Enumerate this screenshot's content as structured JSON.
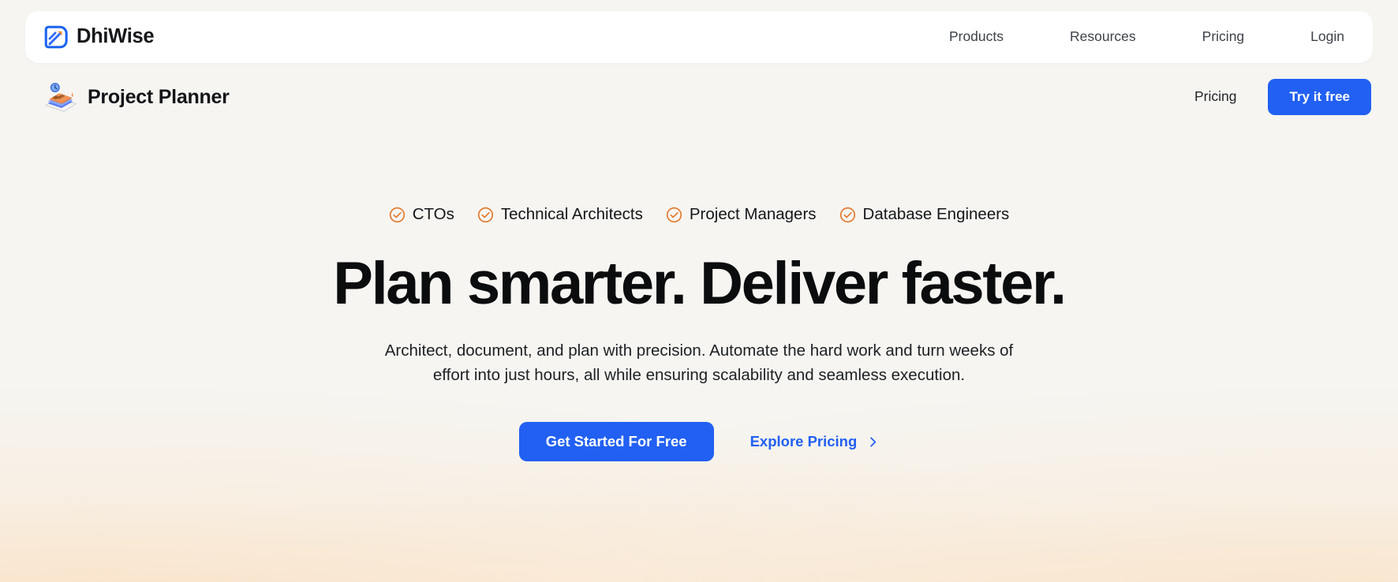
{
  "colors": {
    "page_bg": "#f6f5f1",
    "card_bg": "#ffffff",
    "accent_blue": "#2160f2",
    "accent_orange": "#e2762a",
    "text_dark": "#0b0c0e",
    "glow_peach": "#faddbe"
  },
  "topnav": {
    "brand": {
      "name": "DhiWise",
      "logo_icon": "dhiwise-logo-icon"
    },
    "links": [
      {
        "label": "Products"
      },
      {
        "label": "Resources"
      },
      {
        "label": "Pricing"
      },
      {
        "label": "Login"
      }
    ]
  },
  "subheader": {
    "product_icon": "project-planner-notebook-icon",
    "product_title": "Project Planner",
    "pricing_link": "Pricing",
    "try_button": "Try it free"
  },
  "hero": {
    "audience": [
      {
        "icon": "circle-check-icon",
        "label": "CTOs"
      },
      {
        "icon": "circle-check-icon",
        "label": "Technical Architects"
      },
      {
        "icon": "circle-check-icon",
        "label": "Project Managers"
      },
      {
        "icon": "circle-check-icon",
        "label": "Database Engineers"
      }
    ],
    "headline": "Plan smarter. Deliver faster.",
    "subheadline": "Architect, document, and plan with precision. Automate the hard work and turn weeks of effort into just hours, all while ensuring scalability and seamless execution.",
    "primary_cta": "Get Started For Free",
    "secondary_cta": "Explore Pricing",
    "secondary_cta_icon": "chevron-right-icon"
  }
}
